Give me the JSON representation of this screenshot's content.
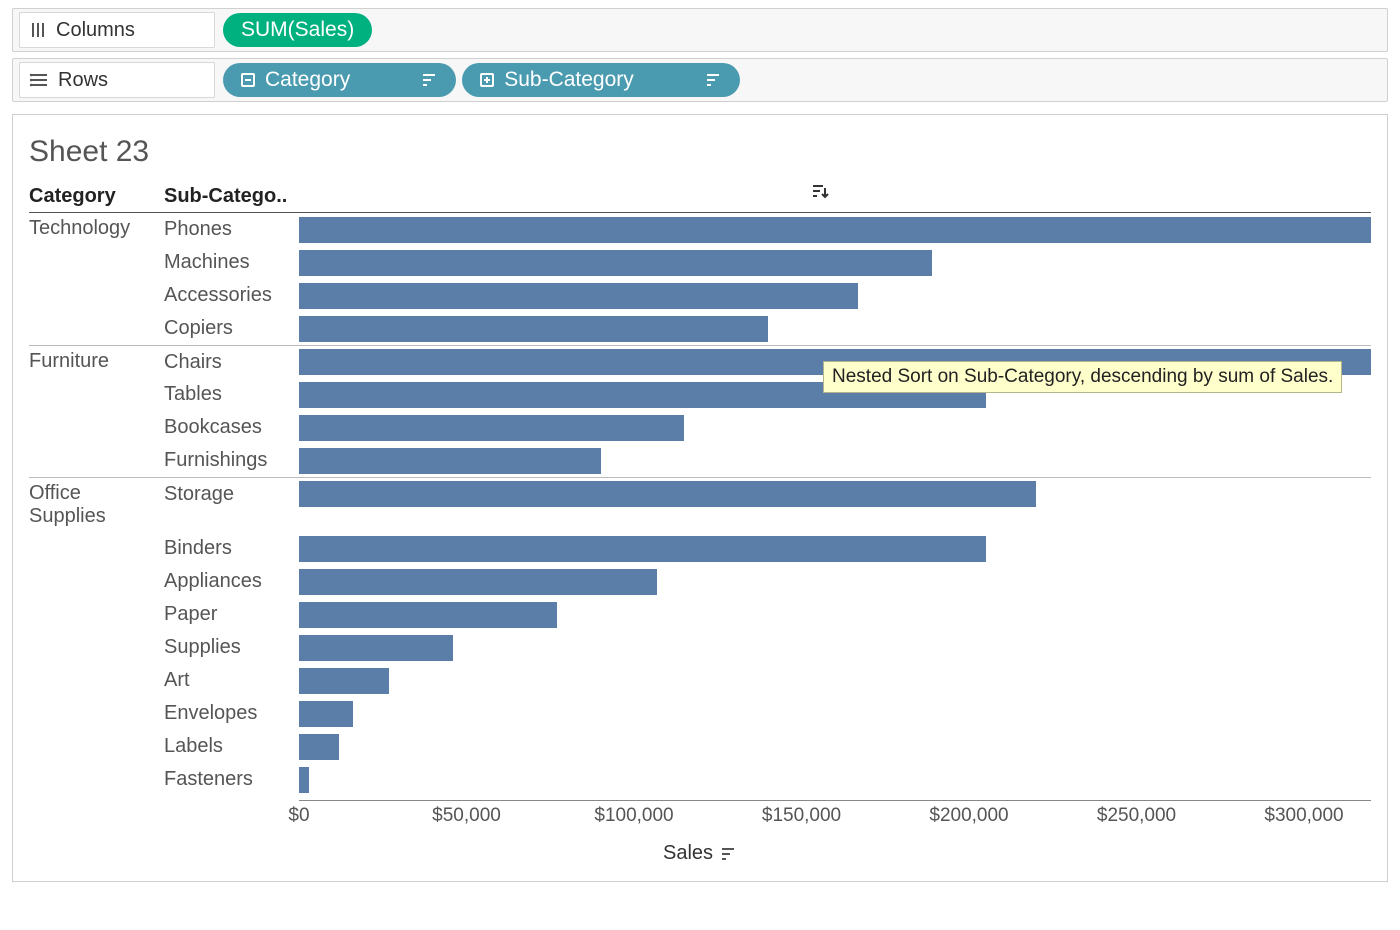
{
  "shelves": {
    "columns_label": "Columns",
    "rows_label": "Rows",
    "columns_pills": [
      {
        "label": "SUM(Sales)",
        "kind": "measure"
      }
    ],
    "rows_pills": [
      {
        "label": "Category",
        "kind": "dimension",
        "expand_icon": "minus",
        "sort_icon": true
      },
      {
        "label": "Sub-Category",
        "kind": "dimension",
        "expand_icon": "plus",
        "sort_icon": true
      }
    ]
  },
  "sheet_title": "Sheet 23",
  "headers": {
    "category": "Category",
    "subcategory": "Sub-Catego.."
  },
  "tooltip": "Nested Sort on Sub-Category, descending by sum of Sales.",
  "axis": {
    "label": "Sales",
    "ticks_text": [
      "$0",
      "$50,000",
      "$100,000",
      "$150,000",
      "$200,000",
      "$250,000",
      "$300,000"
    ],
    "sort_indicator": true
  },
  "chart_data": {
    "type": "bar",
    "xlabel": "Sales",
    "ylabel": "",
    "xlim": [
      0,
      320000
    ],
    "ticks": [
      0,
      50000,
      100000,
      150000,
      200000,
      250000,
      300000
    ],
    "groups": [
      {
        "category": "Technology",
        "rows": [
          {
            "sub": "Phones",
            "value": 330000
          },
          {
            "sub": "Machines",
            "value": 189000
          },
          {
            "sub": "Accessories",
            "value": 167000
          },
          {
            "sub": "Copiers",
            "value": 140000
          }
        ]
      },
      {
        "category": "Furniture",
        "rows": [
          {
            "sub": "Chairs",
            "value": 325000
          },
          {
            "sub": "Tables",
            "value": 205000
          },
          {
            "sub": "Bookcases",
            "value": 115000
          },
          {
            "sub": "Furnishings",
            "value": 90000
          }
        ]
      },
      {
        "category": "Office Supplies",
        "rows": [
          {
            "sub": "Storage",
            "value": 220000
          },
          {
            "sub": "Binders",
            "value": 205000
          },
          {
            "sub": "Appliances",
            "value": 107000
          },
          {
            "sub": "Paper",
            "value": 77000
          },
          {
            "sub": "Supplies",
            "value": 46000
          },
          {
            "sub": "Art",
            "value": 27000
          },
          {
            "sub": "Envelopes",
            "value": 16000
          },
          {
            "sub": "Labels",
            "value": 12000
          },
          {
            "sub": "Fasteners",
            "value": 3000
          }
        ]
      }
    ]
  },
  "colors": {
    "bar": "#5b7ea8",
    "measure_pill": "#00b180",
    "dimension_pill": "#4b9bb0"
  }
}
